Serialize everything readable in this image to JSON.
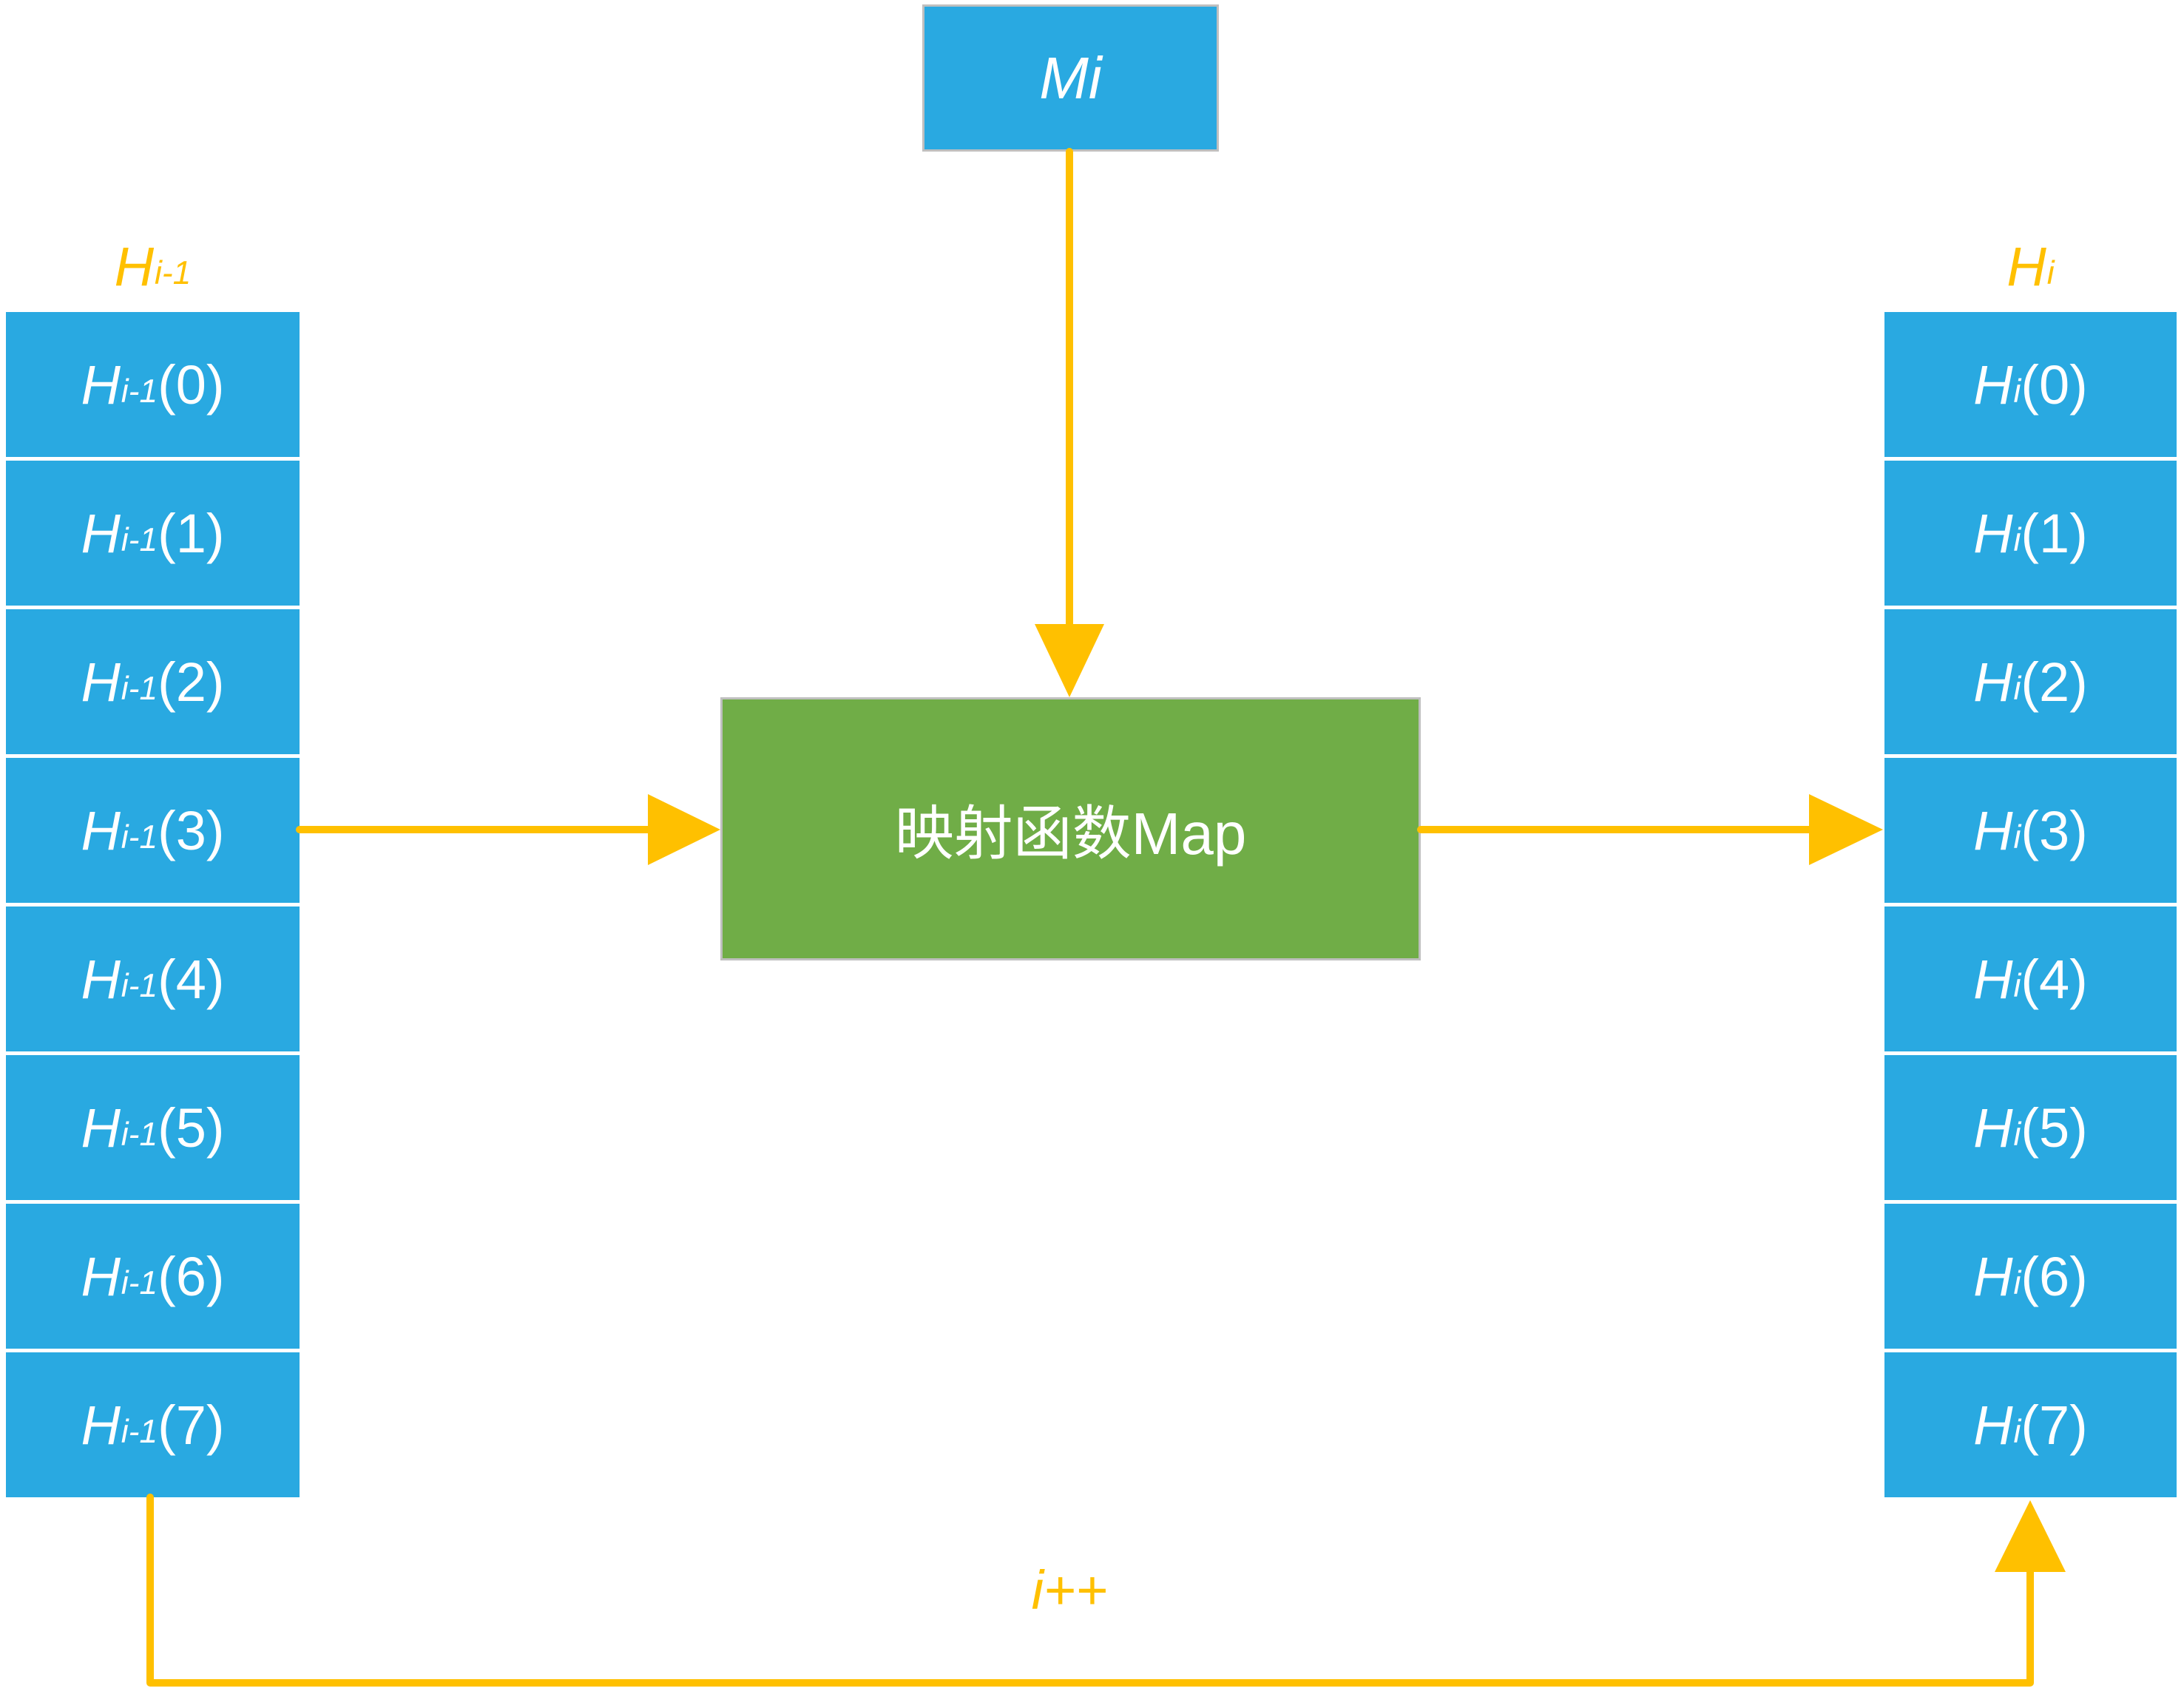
{
  "diagram": {
    "input_box": {
      "label": "Mi"
    },
    "map_box": {
      "label": "映射函数Map"
    },
    "left_column": {
      "heading": {
        "var": "H",
        "sub": "i-1"
      },
      "cells": [
        {
          "var": "H",
          "sub": "i-1",
          "arg": "(0)"
        },
        {
          "var": "H",
          "sub": "i-1",
          "arg": "(1)"
        },
        {
          "var": "H",
          "sub": "i-1",
          "arg": "(2)"
        },
        {
          "var": "H",
          "sub": "i-1",
          "arg": "(3)"
        },
        {
          "var": "H",
          "sub": "i-1",
          "arg": "(4)"
        },
        {
          "var": "H",
          "sub": "i-1",
          "arg": "(5)"
        },
        {
          "var": "H",
          "sub": "i-1",
          "arg": "(6)"
        },
        {
          "var": "H",
          "sub": "i-1",
          "arg": "(7)"
        }
      ]
    },
    "right_column": {
      "heading": {
        "var": "H",
        "sub": "i"
      },
      "cells": [
        {
          "var": "H",
          "sub": "i",
          "arg": "(0)"
        },
        {
          "var": "H",
          "sub": "i",
          "arg": "(1)"
        },
        {
          "var": "H",
          "sub": "i",
          "arg": "(2)"
        },
        {
          "var": "H",
          "sub": "i",
          "arg": "(3)"
        },
        {
          "var": "H",
          "sub": "i",
          "arg": "(4)"
        },
        {
          "var": "H",
          "sub": "i",
          "arg": "(5)"
        },
        {
          "var": "H",
          "sub": "i",
          "arg": "(6)"
        },
        {
          "var": "H",
          "sub": "i",
          "arg": "(7)"
        }
      ]
    },
    "loop_label": "i++"
  },
  "colors": {
    "cell_fill": "#29A9E1",
    "arrow": "#FFC000",
    "map_fill": "#70AD47",
    "text_on_fill": "#FFFFFF",
    "label_text": "#FFC000"
  }
}
